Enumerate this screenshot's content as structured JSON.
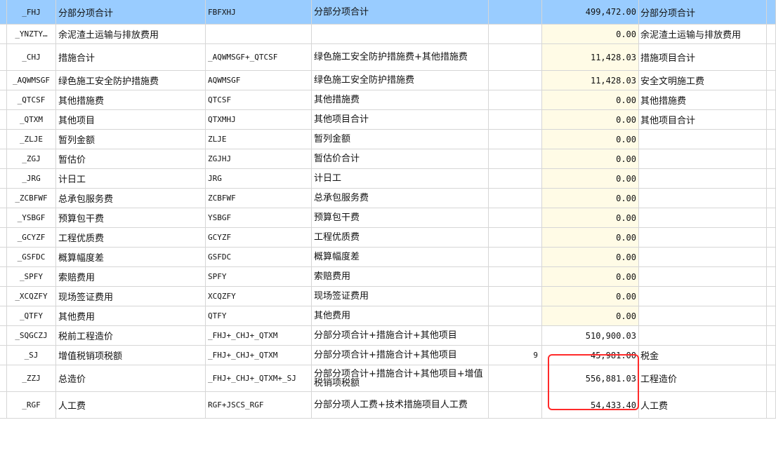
{
  "rows": [
    {
      "code": "_FHJ",
      "name": "分部分项合计",
      "base": "FBFXHJ",
      "desc": "分部分项合计",
      "rate": "",
      "amount": "499,472.00",
      "category": "分部分项合计",
      "selected": true,
      "tall": false,
      "yellow": true
    },
    {
      "code": "_YNZTY…",
      "name": "余泥渣土运输与排放费用",
      "base": "",
      "desc": "",
      "rate": "",
      "amount": "0.00",
      "category": "余泥渣土运输与排放费用",
      "selected": false,
      "tall": false,
      "yellow": true
    },
    {
      "code": "_CHJ",
      "name": "措施合计",
      "base": "_AQWMSGF+_QTCSF",
      "desc": "绿色施工安全防护措施费+其他措施费",
      "rate": "",
      "amount": "11,428.03",
      "category": "措施项目合计",
      "selected": false,
      "tall": true,
      "yellow": true
    },
    {
      "code": "_AQWMSGF",
      "name": "绿色施工安全防护措施费",
      "base": "AQWMSGF",
      "desc": "绿色施工安全防护措施费",
      "rate": "",
      "amount": "11,428.03",
      "category": "安全文明施工费",
      "selected": false,
      "tall": false,
      "yellow": true
    },
    {
      "code": "_QTCSF",
      "name": "其他措施费",
      "base": "QTCSF",
      "desc": "其他措施费",
      "rate": "",
      "amount": "0.00",
      "category": "其他措施费",
      "selected": false,
      "tall": false,
      "yellow": true
    },
    {
      "code": "_QTXM",
      "name": "其他项目",
      "base": "QTXMHJ",
      "desc": "其他项目合计",
      "rate": "",
      "amount": "0.00",
      "category": "其他项目合计",
      "selected": false,
      "tall": false,
      "yellow": true
    },
    {
      "code": "_ZLJE",
      "name": "暂列金额",
      "base": "ZLJE",
      "desc": "暂列金额",
      "rate": "",
      "amount": "0.00",
      "category": "",
      "selected": false,
      "tall": false,
      "yellow": true
    },
    {
      "code": "_ZGJ",
      "name": "暂估价",
      "base": "ZGJHJ",
      "desc": "暂估价合计",
      "rate": "",
      "amount": "0.00",
      "category": "",
      "selected": false,
      "tall": false,
      "yellow": true
    },
    {
      "code": "_JRG",
      "name": "计日工",
      "base": "JRG",
      "desc": "计日工",
      "rate": "",
      "amount": "0.00",
      "category": "",
      "selected": false,
      "tall": false,
      "yellow": true
    },
    {
      "code": "_ZCBFWF",
      "name": "总承包服务费",
      "base": "ZCBFWF",
      "desc": "总承包服务费",
      "rate": "",
      "amount": "0.00",
      "category": "",
      "selected": false,
      "tall": false,
      "yellow": true
    },
    {
      "code": "_YSBGF",
      "name": "预算包干费",
      "base": "YSBGF",
      "desc": "预算包干费",
      "rate": "",
      "amount": "0.00",
      "category": "",
      "selected": false,
      "tall": false,
      "yellow": true
    },
    {
      "code": "_GCYZF",
      "name": "工程优质费",
      "base": "GCYZF",
      "desc": "工程优质费",
      "rate": "",
      "amount": "0.00",
      "category": "",
      "selected": false,
      "tall": false,
      "yellow": true
    },
    {
      "code": "_GSFDC",
      "name": "概算幅度差",
      "base": "GSFDC",
      "desc": "概算幅度差",
      "rate": "",
      "amount": "0.00",
      "category": "",
      "selected": false,
      "tall": false,
      "yellow": true
    },
    {
      "code": "_SPFY",
      "name": "索赔费用",
      "base": "SPFY",
      "desc": "索赔费用",
      "rate": "",
      "amount": "0.00",
      "category": "",
      "selected": false,
      "tall": false,
      "yellow": true
    },
    {
      "code": "_XCQZFY",
      "name": "现场签证费用",
      "base": "XCQZFY",
      "desc": "现场签证费用",
      "rate": "",
      "amount": "0.00",
      "category": "",
      "selected": false,
      "tall": false,
      "yellow": true
    },
    {
      "code": "_QTFY",
      "name": "其他费用",
      "base": "QTFY",
      "desc": "其他费用",
      "rate": "",
      "amount": "0.00",
      "category": "",
      "selected": false,
      "tall": false,
      "yellow": true
    },
    {
      "code": "_SQGCZJ",
      "name": "税前工程造价",
      "base": "_FHJ+_CHJ+_QTXM",
      "desc": "分部分项合计+措施合计+其他项目",
      "rate": "",
      "amount": "510,900.03",
      "category": "",
      "selected": false,
      "tall": false,
      "yellow": false
    },
    {
      "code": "_SJ",
      "name": "增值税销项税额",
      "base": "_FHJ+_CHJ+_QTXM",
      "desc": "分部分项合计+措施合计+其他项目",
      "rate": "9",
      "amount": "45,981.00",
      "category": "税金",
      "selected": false,
      "tall": false,
      "yellow": false
    },
    {
      "code": "_ZZJ",
      "name": "总造价",
      "base": "_FHJ+_CHJ+_QTXM+_SJ",
      "desc": "分部分项合计+措施合计+其他项目+增值税销项税额",
      "rate": "",
      "amount": "556,881.03",
      "category": "工程造价",
      "selected": false,
      "tall": true,
      "yellow": false
    },
    {
      "code": "_RGF",
      "name": "人工费",
      "base": "RGF+JSCS_RGF",
      "desc": "分部分项人工费+技术措施项目人工费",
      "rate": "",
      "amount": "54,433.40",
      "category": "人工费",
      "selected": false,
      "tall": true,
      "yellow": false
    }
  ],
  "colors": {
    "selected_row": "#99ccff",
    "yellow_cell": "#fffbe6",
    "highlight": "#ff2a2a"
  }
}
